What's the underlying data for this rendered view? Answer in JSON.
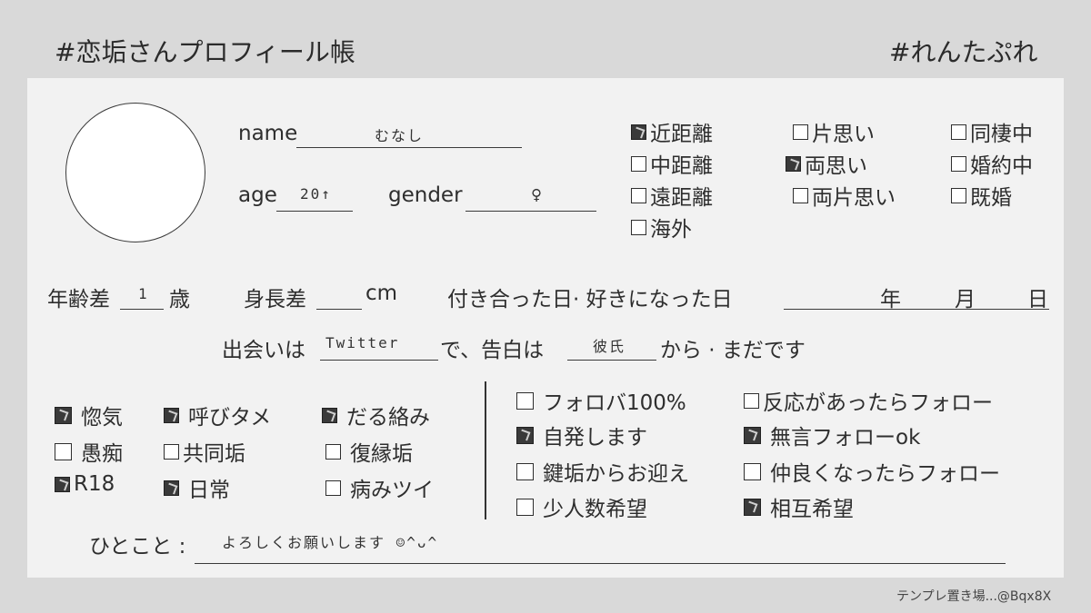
{
  "header": {
    "title": "#恋垢さんプロフィール帳",
    "tag": "#れんたぷれ"
  },
  "profile": {
    "name_label": "name",
    "name_value": "むなし",
    "age_label": "age",
    "age_value": "20↑",
    "gender_label": "gender",
    "gender_value": "♀"
  },
  "distance_options": [
    {
      "label": "近距離",
      "checked": true
    },
    {
      "label": "片思い",
      "checked": false
    },
    {
      "label": "同棲中",
      "checked": false
    },
    {
      "label": "中距離",
      "checked": false
    },
    {
      "label": "両思い",
      "checked": true
    },
    {
      "label": "婚約中",
      "checked": false
    },
    {
      "label": "遠距離",
      "checked": false
    },
    {
      "label": "両片思い",
      "checked": false
    },
    {
      "label": "既婚",
      "checked": false
    },
    {
      "label": "海外",
      "checked": false
    }
  ],
  "diff_row": {
    "age_diff_label": "年齢差",
    "age_diff_value": "1",
    "age_diff_unit": "歳",
    "height_diff_label": "身長差",
    "height_diff_value": "",
    "height_diff_unit": "cm",
    "date_label": "付き合った日· 好きになった日",
    "year": "年",
    "month": "月",
    "day": "日"
  },
  "meet_row": {
    "prefix": "出会いは",
    "meet_value": "Twitter",
    "middle": "で、告白は",
    "confess_value": "彼氏",
    "suffix": "から · まだです"
  },
  "traits": [
    {
      "label": "惚気",
      "checked": true
    },
    {
      "label": "呼びタメ",
      "checked": true
    },
    {
      "label": "だる絡み",
      "checked": true
    },
    {
      "label": "愚痴",
      "checked": false
    },
    {
      "label": "共同垢",
      "checked": false
    },
    {
      "label": "復縁垢",
      "checked": false
    },
    {
      "label": "R18",
      "checked": true
    },
    {
      "label": "日常",
      "checked": true
    },
    {
      "label": "病みツイ",
      "checked": false
    }
  ],
  "follow_options": [
    {
      "label": "フォロバ100%",
      "checked": false
    },
    {
      "label": "反応があったらフォロー",
      "checked": false
    },
    {
      "label": "自発します",
      "checked": true
    },
    {
      "label": "無言フォローok",
      "checked": true
    },
    {
      "label": "鍵垢からお迎え",
      "checked": false
    },
    {
      "label": "仲良くなったらフォロー",
      "checked": false
    },
    {
      "label": "少人数希望",
      "checked": false
    },
    {
      "label": "相互希望",
      "checked": true
    }
  ],
  "comment": {
    "label": "ひとこと :",
    "value": "よろしくお願いします ☺^ᴗ^"
  },
  "credit": "テンプレ置き場...@Bqx8X",
  "colors": {
    "background": "#d9d9d9",
    "card": "#f2f2f2",
    "ink": "#2b2b2b"
  }
}
